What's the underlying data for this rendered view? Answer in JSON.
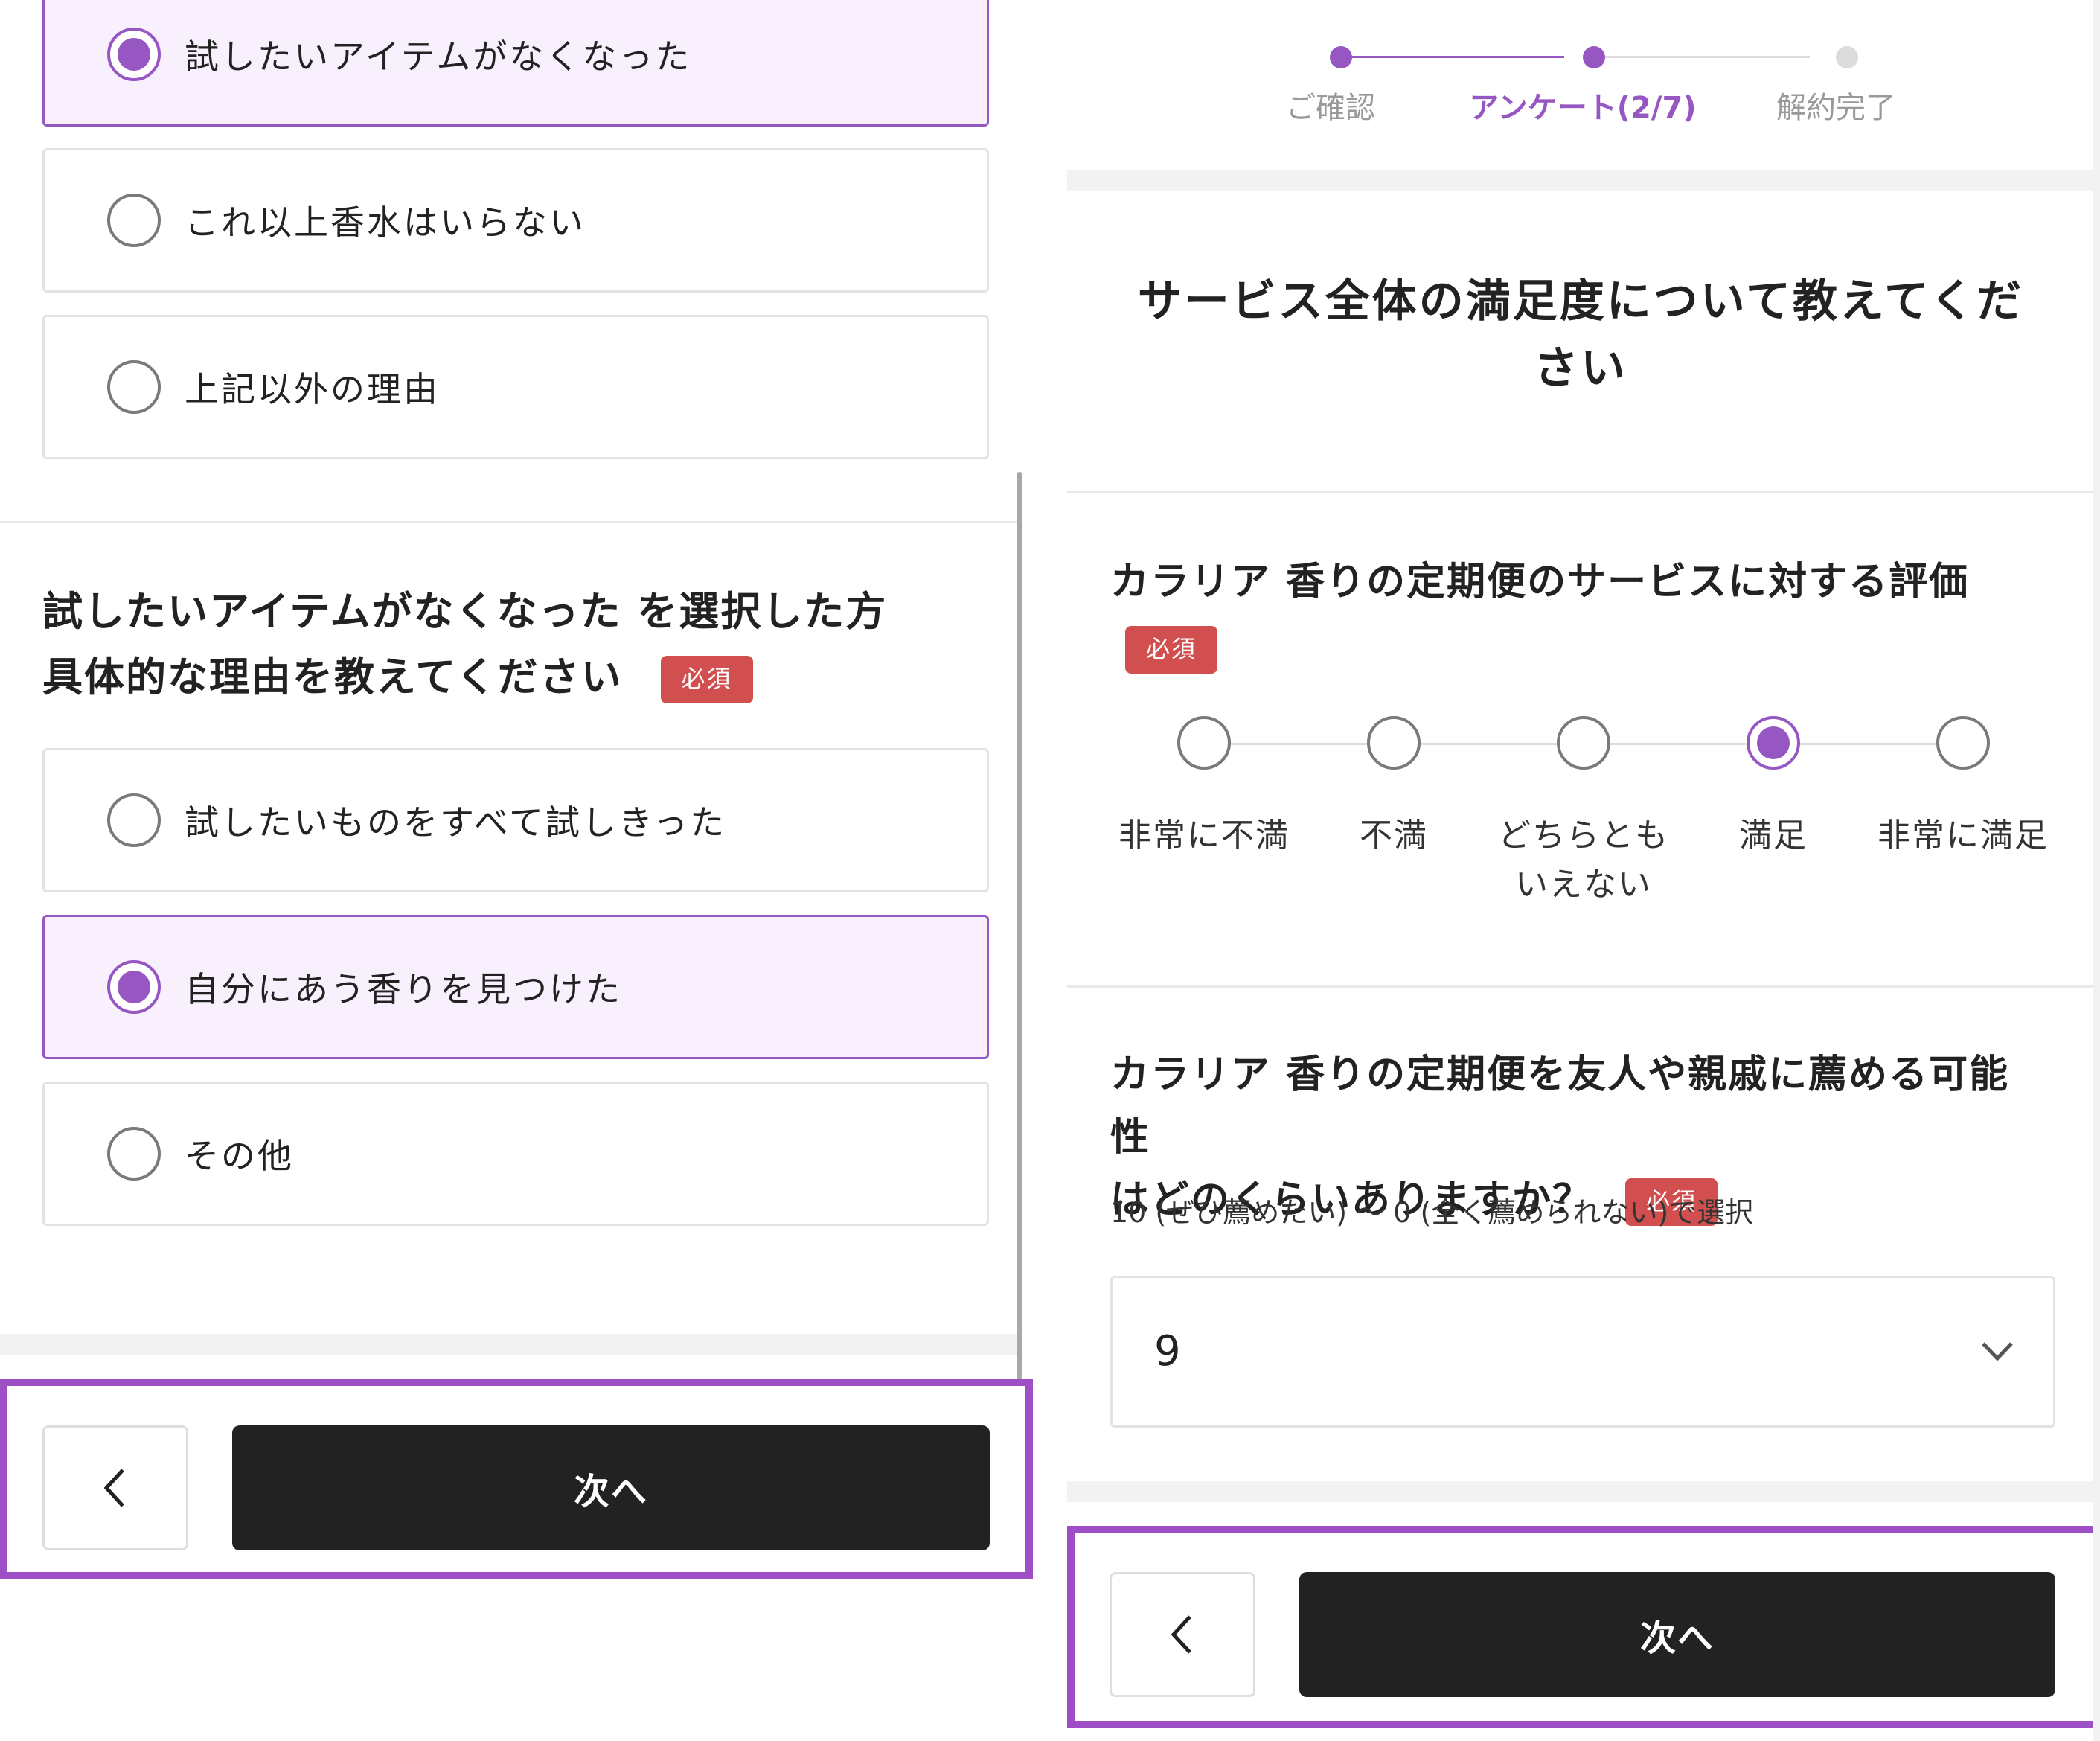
{
  "left": {
    "options_top": [
      {
        "label": "試したいアイテムがなくなった",
        "selected": true
      },
      {
        "label": "これ以上香水はいらない",
        "selected": false
      },
      {
        "label": "上記以外の理由",
        "selected": false
      }
    ],
    "question_line1": "試したいアイテムがなくなった を選択した方",
    "question_line2": "具体的な理由を教えてください",
    "required_badge": "必須",
    "options_bottom": [
      {
        "label": "試したいものをすべて試しきった",
        "selected": false
      },
      {
        "label": "自分にあう香りを見つけた",
        "selected": true
      },
      {
        "label": "その他",
        "selected": false
      }
    ],
    "footer": {
      "back_icon": "chevron-left-icon",
      "next_label": "次へ"
    }
  },
  "right": {
    "steps": [
      {
        "label": "ご確認",
        "state": "done"
      },
      {
        "label": "アンケート(2/7)",
        "state": "active"
      },
      {
        "label": "解約完了",
        "state": "todo"
      }
    ],
    "section_title": "サービス全体の満足度について教えてください",
    "q_rating": {
      "text": "カラリア 香りの定期便のサービスに対する評価",
      "required_badge": "必須",
      "choices": [
        {
          "label": "非常に不満",
          "selected": false
        },
        {
          "label": "不満",
          "selected": false
        },
        {
          "label": "どちらとも いえない",
          "selected": false
        },
        {
          "label": "満足",
          "selected": true
        },
        {
          "label": "非常に満足",
          "selected": false
        }
      ]
    },
    "q_recommend": {
      "line1": "カラリア 香りの定期便を友人や親戚に薦める可能性",
      "line2": "はどのくらいありますか？",
      "required_badge": "必須",
      "hint": "10 (ぜひ薦めたい) 〜 0 (全く薦められない)で選択",
      "selected_value": "9",
      "dropdown_icon": "chevron-down-icon"
    },
    "footer": {
      "back_icon": "chevron-left-icon",
      "next_label": "次へ"
    }
  },
  "colors": {
    "accent": "#9757c3",
    "selected_bg": "#f8f1fd",
    "required": "#d24f4f",
    "highlight_frame": "#9f4fc6",
    "button_dark": "#222222"
  }
}
